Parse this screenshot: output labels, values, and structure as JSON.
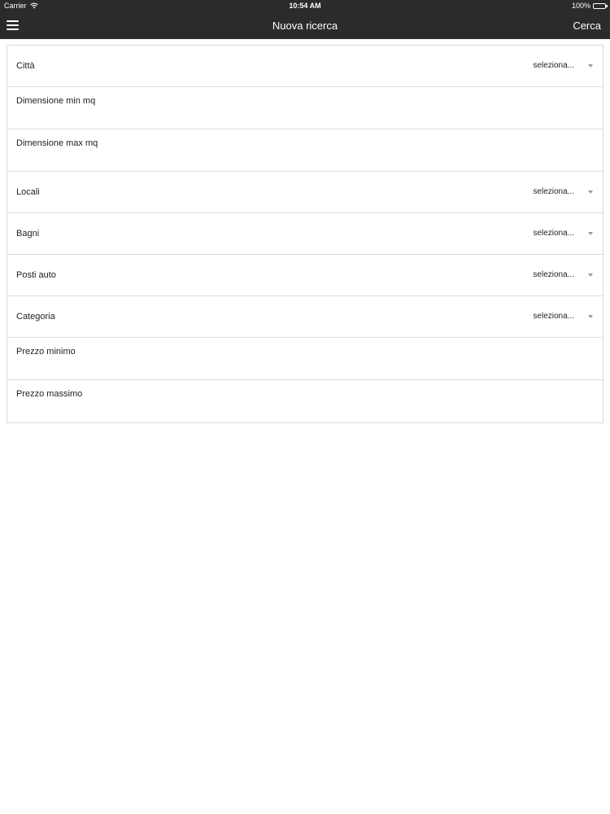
{
  "status_bar": {
    "carrier": "Carrier",
    "wifi_icon": "wifi-icon",
    "time": "10:54 AM",
    "battery": "100%",
    "battery_icon": "battery-full-icon"
  },
  "nav": {
    "menu_icon": "hamburger-menu-icon",
    "title": "Nuova ricerca",
    "action": "Cerca"
  },
  "form": {
    "fields": [
      {
        "label": "Città",
        "type": "select",
        "value": "seleziona..."
      },
      {
        "label": "Dimensione min mq",
        "type": "input",
        "value": ""
      },
      {
        "label": "Dimensione max mq",
        "type": "input",
        "value": ""
      },
      {
        "label": "Locali",
        "type": "select",
        "value": "seleziona..."
      },
      {
        "label": "Bagni",
        "type": "select",
        "value": "seleziona..."
      },
      {
        "label": "Posti auto",
        "type": "select",
        "value": "seleziona..."
      },
      {
        "label": "Categoria",
        "type": "select",
        "value": "seleziona..."
      },
      {
        "label": "Prezzo minimo",
        "type": "input",
        "value": ""
      },
      {
        "label": "Prezzo massimo",
        "type": "input",
        "value": ""
      }
    ]
  },
  "colors": {
    "bar_background": "#2b2b2b",
    "bar_text": "#ffffff",
    "border": "#dcdcdc",
    "text": "#222222",
    "caret": "#999999"
  }
}
